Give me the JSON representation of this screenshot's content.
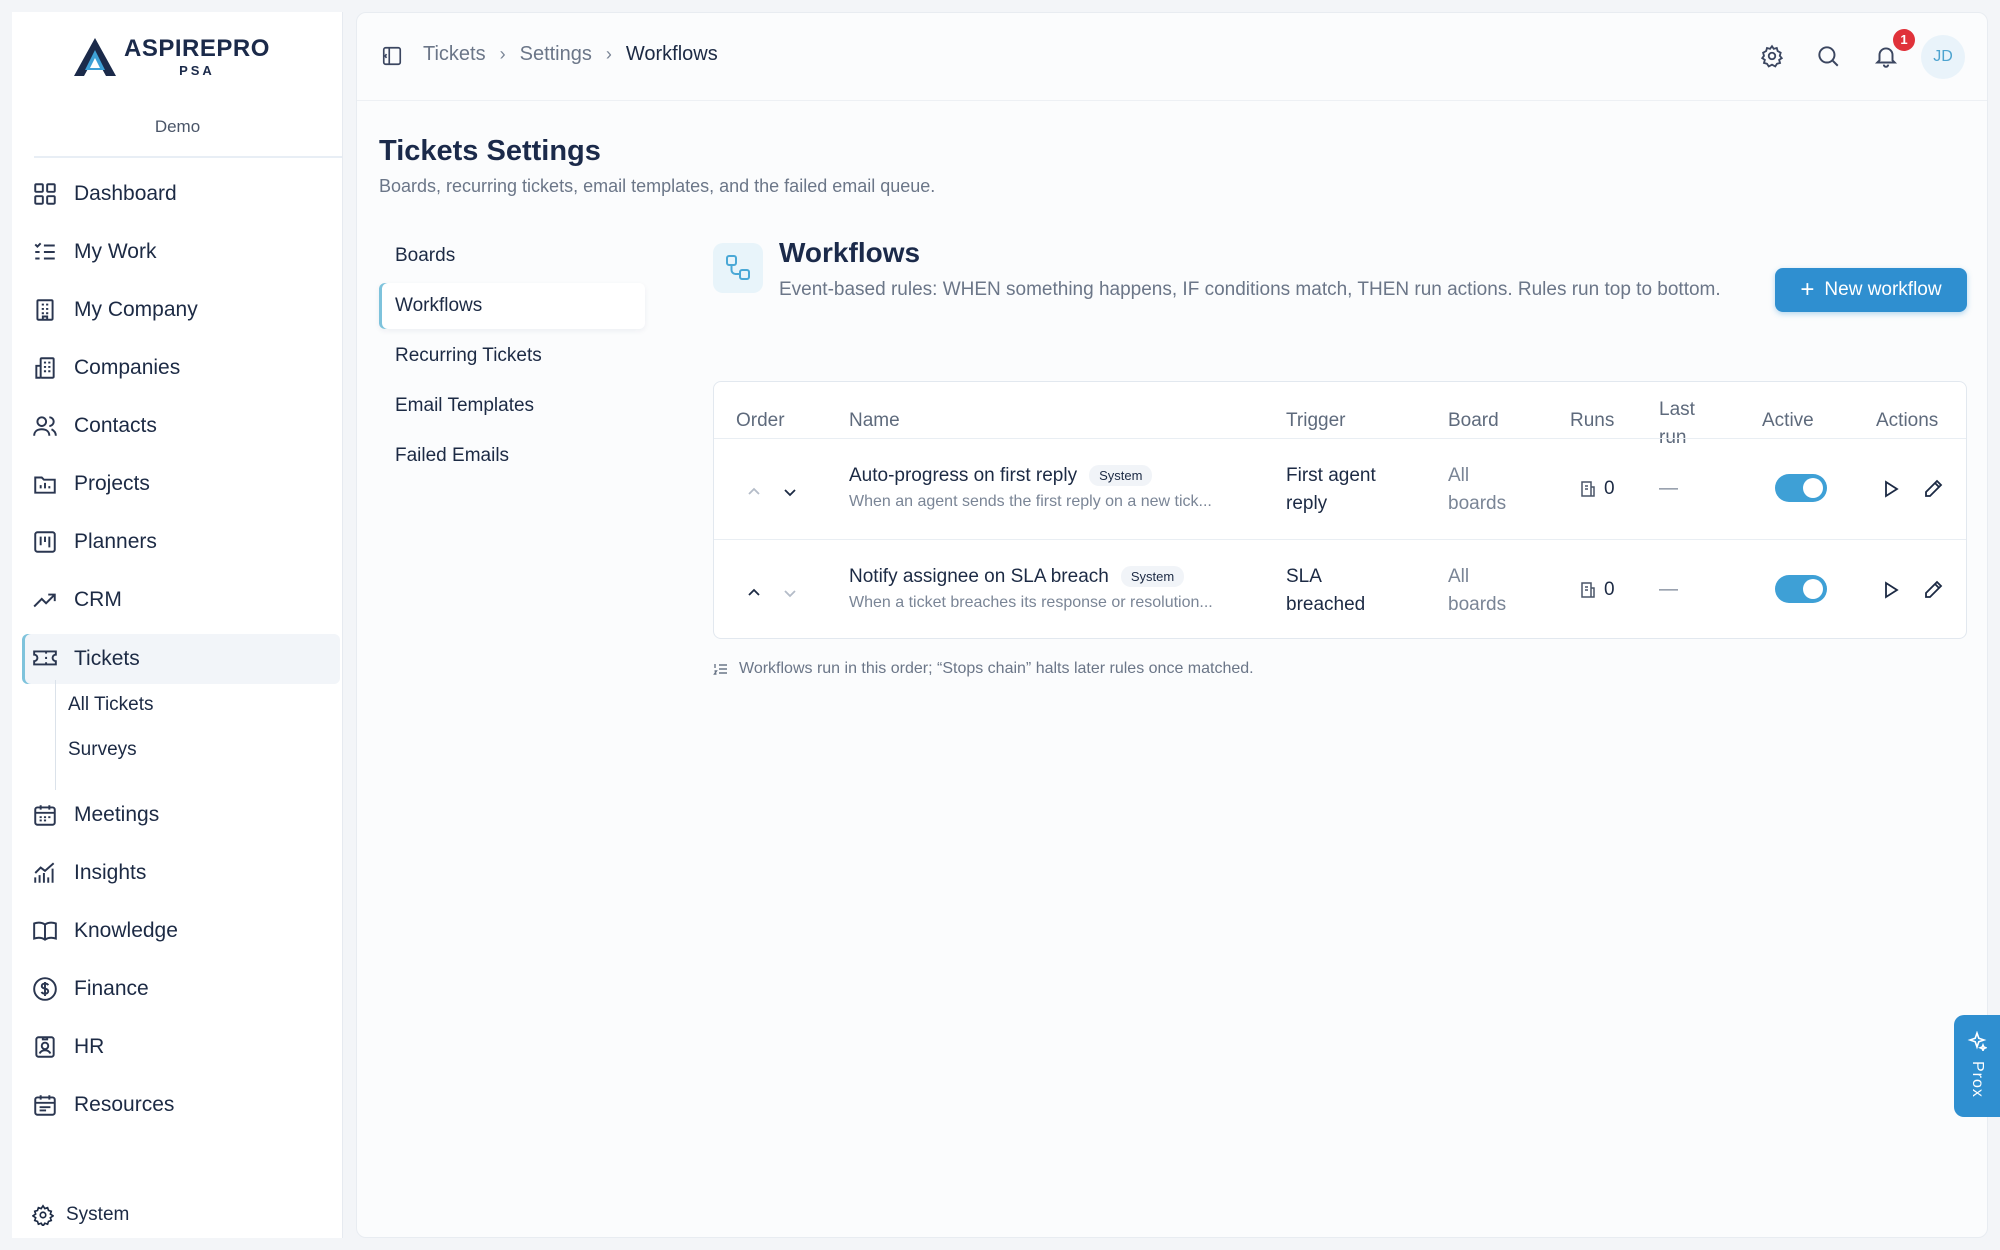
{
  "brand": {
    "name": "ASPIREPRO",
    "sub": "PSA",
    "tenant": "Demo"
  },
  "sidebar": {
    "items": [
      {
        "label": "Dashboard",
        "icon": "dashboard-icon"
      },
      {
        "label": "My Work",
        "icon": "my-work-icon"
      },
      {
        "label": "My Company",
        "icon": "building-icon"
      },
      {
        "label": "Companies",
        "icon": "companies-icon"
      },
      {
        "label": "Contacts",
        "icon": "contacts-icon"
      },
      {
        "label": "Projects",
        "icon": "projects-icon"
      },
      {
        "label": "Planners",
        "icon": "planners-icon"
      },
      {
        "label": "CRM",
        "icon": "trend-icon"
      },
      {
        "label": "Tickets",
        "icon": "ticket-icon",
        "active": true
      },
      {
        "label": "Meetings",
        "icon": "calendar-icon"
      },
      {
        "label": "Insights",
        "icon": "insights-icon"
      },
      {
        "label": "Knowledge",
        "icon": "book-icon"
      },
      {
        "label": "Finance",
        "icon": "dollar-icon"
      },
      {
        "label": "HR",
        "icon": "badge-icon"
      },
      {
        "label": "Resources",
        "icon": "resources-icon"
      }
    ],
    "subitems": [
      "All Tickets",
      "Surveys"
    ],
    "system": "System"
  },
  "breadcrumb": [
    "Tickets",
    "Settings",
    "Workflows"
  ],
  "notifications": {
    "count": "1"
  },
  "user": {
    "initials": "JD"
  },
  "page": {
    "title": "Tickets Settings",
    "subtitle": "Boards, recurring tickets, email templates, and the failed email queue."
  },
  "settings_nav": [
    "Boards",
    "Workflows",
    "Recurring Tickets",
    "Email Templates",
    "Failed Emails"
  ],
  "section": {
    "title": "Workflows",
    "description": "Event-based rules: WHEN something happens, IF conditions match, THEN run actions. Rules run top to bottom.",
    "new_button": "New workflow"
  },
  "table": {
    "headers": [
      "Order",
      "Name",
      "Trigger",
      "Board",
      "Runs",
      "Last run",
      "Active",
      "Actions"
    ],
    "header_last_run": [
      "Last",
      "run"
    ],
    "rows": [
      {
        "name": "Auto-progress on first reply",
        "badge": "System",
        "description": "When an agent sends the first reply on a new tick...",
        "trigger": [
          "First agent",
          "reply"
        ],
        "board": [
          "All",
          "boards"
        ],
        "runs": "0",
        "last_run": "—",
        "active": true
      },
      {
        "name": "Notify assignee on SLA breach",
        "badge": "System",
        "description": "When a ticket breaches its response or resolution...",
        "trigger": [
          "SLA",
          "breached"
        ],
        "board": [
          "All",
          "boards"
        ],
        "runs": "0",
        "last_run": "—",
        "active": true
      }
    ]
  },
  "footnote": "Workflows run in this order; “Stops chain” halts later rules once matched.",
  "assistant_tab": "Prox",
  "colors": {
    "accent": "#2f8fd0",
    "toggle": "#3ea0d6",
    "badge": "#e0323a"
  }
}
